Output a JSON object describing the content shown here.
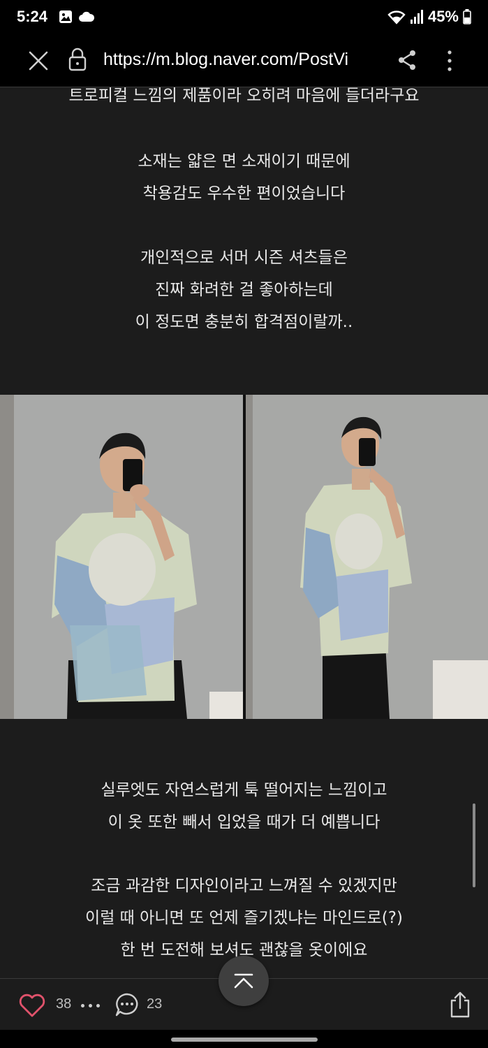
{
  "status_bar": {
    "time": "5:24",
    "battery": "45%"
  },
  "browser": {
    "url": "https://m.blog.naver.com/PostVi"
  },
  "post": {
    "para1": [
      "트로피컬 느낌의 제품이라 오히려 마음에 들더라구요"
    ],
    "para2": [
      "소재는 얇은 면 소재이기 때문에",
      "착용감도 우수한 편이었습니다"
    ],
    "para3": [
      "개인적으로 서머 시즌 셔츠들은",
      "진짜 화려한 걸 좋아하는데",
      "이 정도면 충분히 합격점이랄까.."
    ],
    "para4": [
      "실루엣도 자연스럽게 툭 떨어지는 느낌이고",
      "이 옷 또한 빼서 입었을 때가 더 예쁩니다"
    ],
    "para5": [
      "조금 과감한 디자인이라고 느껴질 수 있겠지만",
      "이럴 때 아니면 또 언제 즐기겠냐는 마인드로(?)",
      "한 번 도전해 보셔도 괜찮을 옷이에요"
    ]
  },
  "bottom_bar": {
    "like_count": "38",
    "comment_count": "23"
  },
  "colors": {
    "background": "#1c1c1c",
    "like_heart": "#e0526b",
    "text": "#e8e8e8"
  }
}
